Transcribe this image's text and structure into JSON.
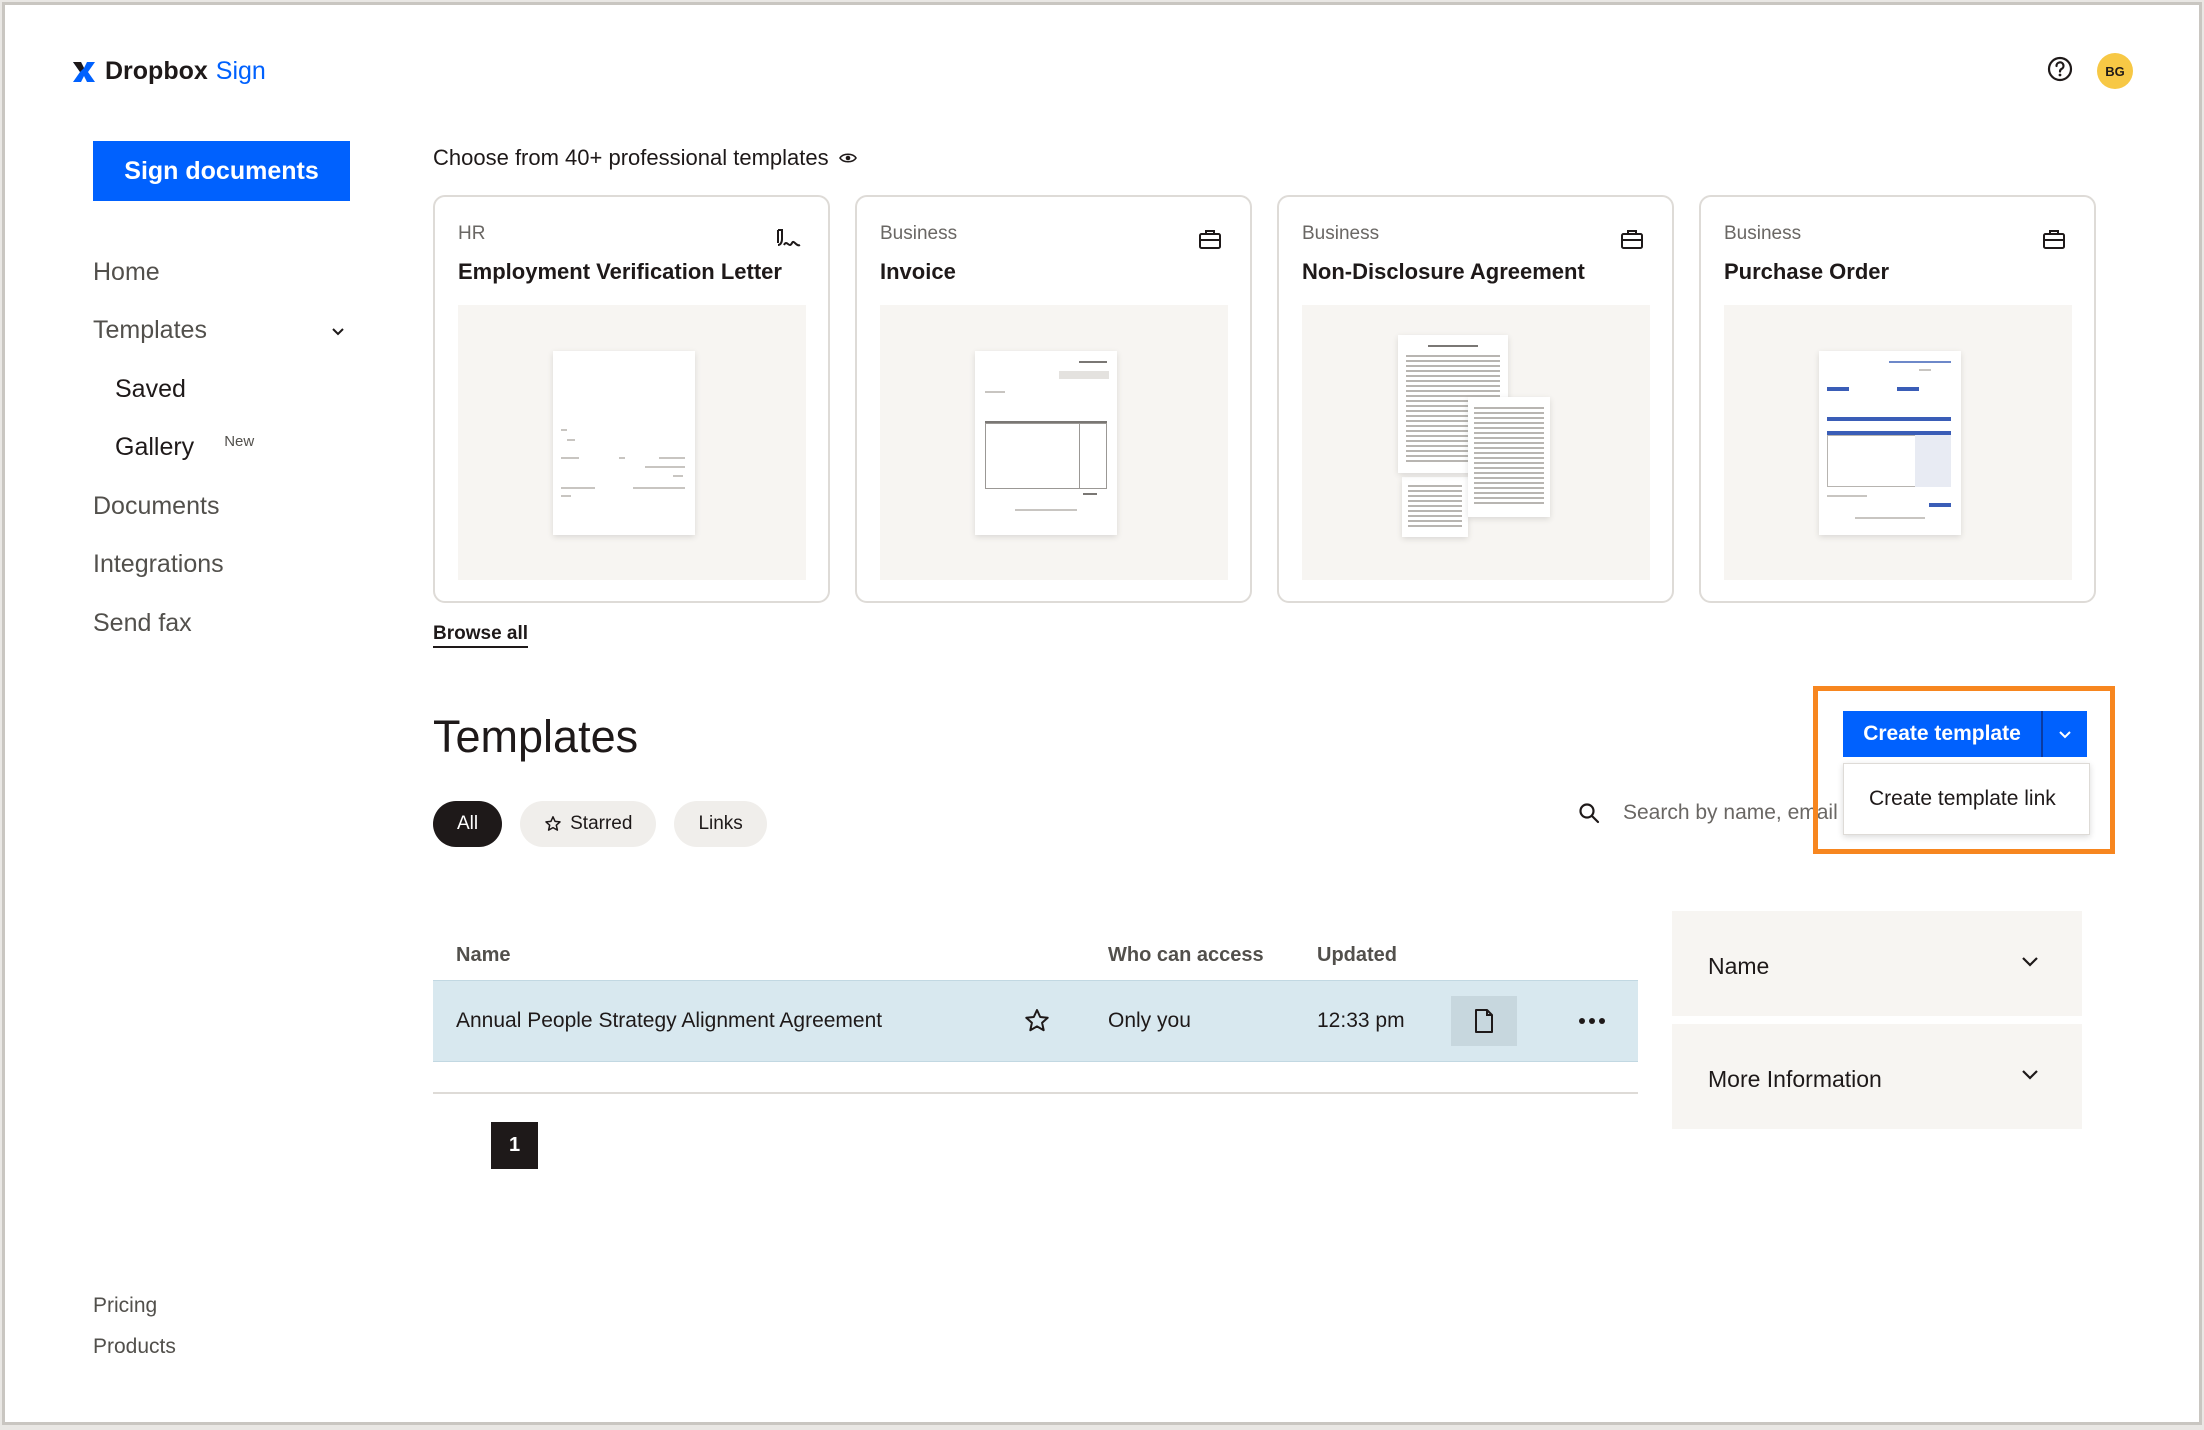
{
  "app": {
    "brand_bold": "Dropbox",
    "brand_light": "Sign",
    "avatar_initials": "BG",
    "accent_color": "#0061fe",
    "highlight_color": "#f7861f"
  },
  "sidebar": {
    "sign_button": "Sign documents",
    "items": [
      {
        "label": "Home"
      },
      {
        "label": "Templates",
        "expanded": true
      },
      {
        "label": "Saved"
      },
      {
        "label": "Gallery",
        "badge": "New"
      },
      {
        "label": "Documents"
      },
      {
        "label": "Integrations"
      },
      {
        "label": "Send fax"
      }
    ],
    "footer": [
      "Pricing",
      "Products"
    ]
  },
  "gallery": {
    "title": "Choose from 40+ professional templates",
    "cards": [
      {
        "category": "HR",
        "name": "Employment Verification Letter",
        "icon": "signature-icon"
      },
      {
        "category": "Business",
        "name": "Invoice",
        "icon": "briefcase-icon"
      },
      {
        "category": "Business",
        "name": "Non-Disclosure Agreement",
        "icon": "briefcase-icon"
      },
      {
        "category": "Business",
        "name": "Purchase Order",
        "icon": "briefcase-icon"
      }
    ],
    "browse_all": "Browse all"
  },
  "templates": {
    "heading": "Templates",
    "filters": [
      {
        "label": "All",
        "active": true
      },
      {
        "label": "Starred"
      },
      {
        "label": "Links"
      }
    ],
    "search_placeholder": "Search by name, email",
    "create_button": "Create template",
    "dropdown_item": "Create template link",
    "columns": {
      "name": "Name",
      "access": "Who can access",
      "updated": "Updated"
    },
    "rows": [
      {
        "name": "Annual People Strategy Alignment Agreement",
        "access": "Only you",
        "updated": "12:33 pm"
      }
    ],
    "page": "1"
  },
  "panel": {
    "items": [
      {
        "title": "Name"
      },
      {
        "title": "More Information"
      }
    ]
  }
}
